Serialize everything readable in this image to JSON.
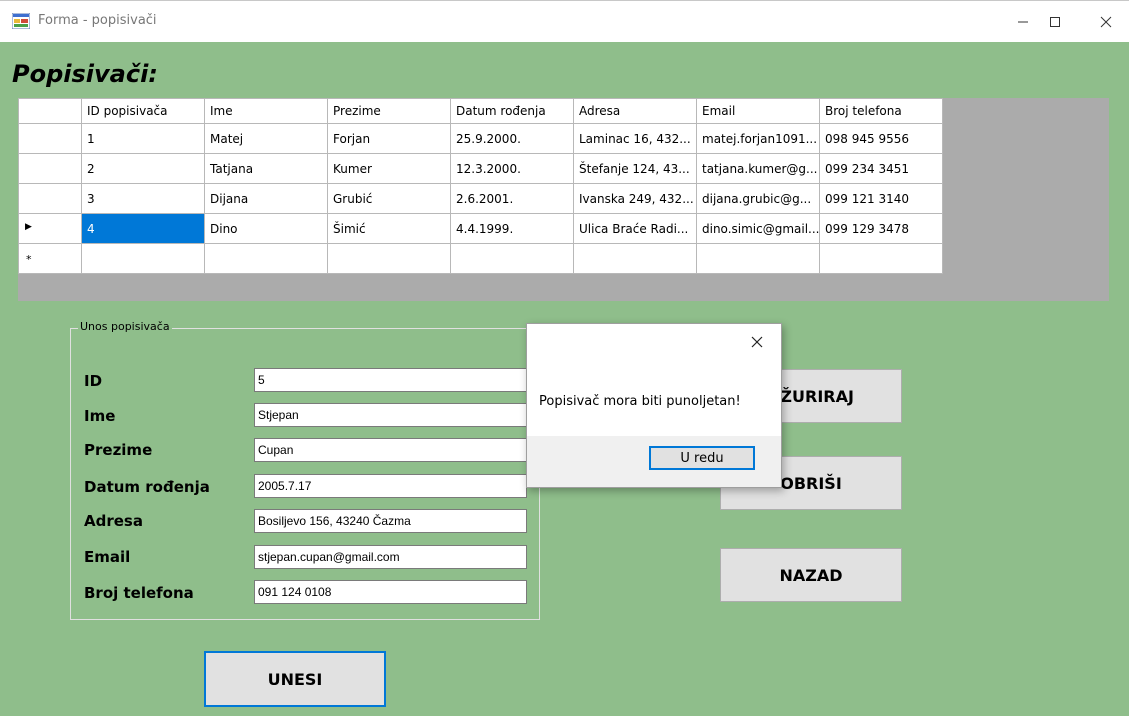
{
  "window": {
    "title": "Forma - popisivači",
    "icon": "form-app-icon",
    "controls": [
      "minimize-icon",
      "maximize-icon",
      "close-icon"
    ]
  },
  "heading": "Popisivači:",
  "grid": {
    "columns": [
      "ID popisivača",
      "Ime",
      "Prezime",
      "Datum rođenja",
      "Adresa",
      "Email",
      "Broj telefona"
    ],
    "rows": [
      [
        "1",
        "Matej",
        "Forjan",
        "25.9.2000.",
        "Laminac 16, 432...",
        "matej.forjan1091...",
        "098 945 9556"
      ],
      [
        "2",
        "Tatjana",
        "Kumer",
        "12.3.2000.",
        "Štefanje 124, 43...",
        "tatjana.kumer@g...",
        "099 234 3451"
      ],
      [
        "3",
        "Dijana",
        "Grubić",
        "2.6.2001.",
        "Ivanska 249, 432...",
        "dijana.grubic@g...",
        "099 121 3140"
      ],
      [
        "4",
        "Dino",
        "Šimić",
        "4.4.1999.",
        "Ulica Braće Radi...",
        "dino.simic@gmail...",
        "099 129 3478"
      ]
    ],
    "current_row_marker": "▶",
    "new_row_marker": "*"
  },
  "form": {
    "group_title": "Unos popisivača",
    "fields": [
      {
        "label": "ID",
        "value": "5"
      },
      {
        "label": "Ime",
        "value": "Stjepan"
      },
      {
        "label": "Prezime",
        "value": "Cupan"
      },
      {
        "label": "Datum rođenja",
        "value": "2005.7.17"
      },
      {
        "label": "Adresa",
        "value": "Bosiljevo 156, 43240 Čazma"
      },
      {
        "label": "Email",
        "value": "stjepan.cupan@gmail.com"
      },
      {
        "label": "Broj telefona",
        "value": "091 124 0108"
      }
    ]
  },
  "buttons": {
    "azuriraj": "AŽURIRAJ",
    "obrisi": "OBRIŠI",
    "nazad": "NAZAD",
    "unesi": "UNESI"
  },
  "dialog": {
    "message": "Popisivač mora biti punoljetan!",
    "ok": "U redu"
  },
  "colors": {
    "form_background": "#8fbe8b",
    "selection": "#0078d7",
    "grid_background": "#ababab"
  }
}
